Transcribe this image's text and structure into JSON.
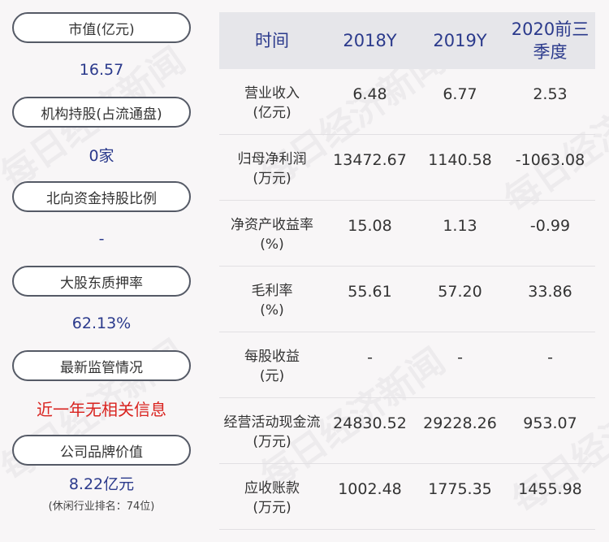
{
  "left_panel": {
    "items": [
      {
        "label": "市值(亿元)",
        "value": "16.57"
      },
      {
        "label": "机构持股(占流通盘)",
        "value": "0家"
      },
      {
        "label": "北向资金持股比例",
        "value": "-"
      },
      {
        "label": "大股东质押率",
        "value": "62.13%"
      },
      {
        "label": "最新监管情况",
        "value": "近一年无相关信息"
      },
      {
        "label": "公司品牌价值",
        "value": "8.22亿元",
        "note": "(休闲行业排名：74位)"
      }
    ]
  },
  "table": {
    "headers": [
      "时间",
      "2018Y",
      "2019Y",
      "2020前三季度"
    ],
    "rows": [
      {
        "name": "营业收入",
        "unit": "(亿元)",
        "values": [
          "6.48",
          "6.77",
          "2.53"
        ]
      },
      {
        "name": "归母净利润",
        "unit": "(万元)",
        "values": [
          "13472.67",
          "1140.58",
          "-1063.08"
        ]
      },
      {
        "name": "净资产收益率",
        "unit": "(%)",
        "values": [
          "15.08",
          "1.13",
          "-0.99"
        ]
      },
      {
        "name": "毛利率",
        "unit": "(%)",
        "values": [
          "55.61",
          "57.20",
          "33.86"
        ]
      },
      {
        "name": "每股收益",
        "unit": "(元)",
        "values": [
          "-",
          "-",
          "-"
        ]
      },
      {
        "name": "经营活动现金流",
        "unit": "(万元)",
        "values": [
          "24830.52",
          "29228.26",
          "953.07"
        ]
      },
      {
        "name": "应收账款",
        "unit": "(万元)",
        "values": [
          "1002.48",
          "1775.35",
          "1455.98"
        ]
      }
    ]
  },
  "watermark": "每日经济新闻",
  "colors": {
    "value_text": "#2b3a8c",
    "alert_text": "#d9231f",
    "header_bg": "#e6e6ea",
    "pill_border": "#555a66"
  }
}
